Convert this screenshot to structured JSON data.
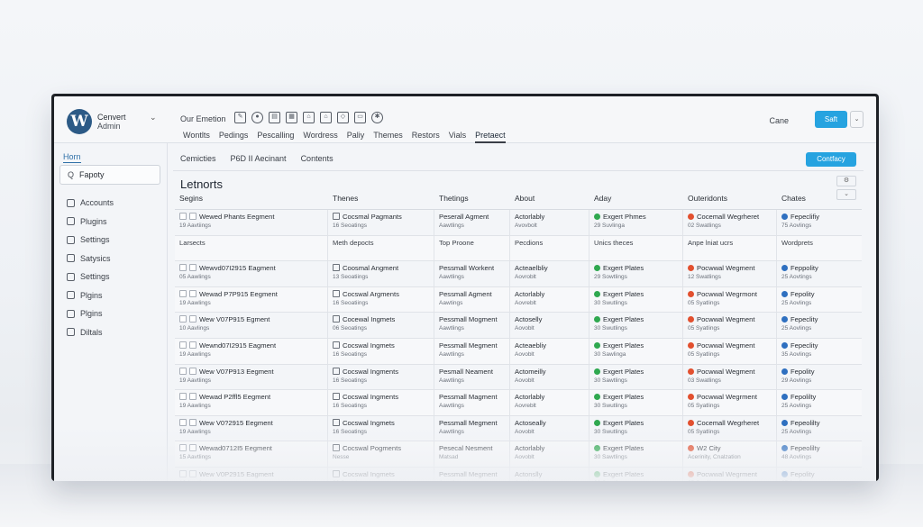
{
  "app": {
    "site_name": "Cenvert",
    "site_sub": "Admin",
    "logo_letter": "W",
    "toolbar_label": "Our Emetion",
    "cane_label": "Cane",
    "save_label": "Saft",
    "nav_tabs": [
      "Wontlts",
      "Pedings",
      "Pescalling",
      "Wordress",
      "Paliy",
      "Themes",
      "Restors",
      "Vials",
      "Pretaect"
    ]
  },
  "sidebar": {
    "home": "Horn",
    "search": "Fapoty",
    "items": [
      "Accounts",
      "Plugins",
      "Settings",
      "Satysics",
      "Settings",
      "Plgins",
      "Plgins",
      "Diltals"
    ]
  },
  "main": {
    "subtabs": [
      "Cemicties",
      "P6D II Aecinant",
      "Contents"
    ],
    "primary_button": "Contfacy",
    "title": "Letnorts",
    "headers": [
      "Segins",
      "Thenes",
      "Thetings",
      "About",
      "Aday",
      "Outeridonts",
      "Chates"
    ],
    "rows": [
      {
        "section": false,
        "c0": "Wewed Phants Eegment",
        "c0s": "19 Aavtiings",
        "c1": "Cocsmal Pagmants",
        "c1s": "16 Seoatings",
        "c2": "Peserall Agment",
        "c2s": "Aawtlings",
        "c3": "Actorlably",
        "c3s": "Avovbolt",
        "c4": "Exgert Phmes",
        "c4s": "29 Suvlinga",
        "c5": "Cocemall Wegrheret",
        "c5s": "02 Swatlings",
        "c6": "Fepeclifiy",
        "c6s": "75 Aovlings"
      },
      {
        "section": true,
        "c0": "Larsects",
        "c0s": "",
        "c1": "Meth depocts",
        "c1s": "",
        "c2": "Top Proone",
        "c2s": "",
        "c3": "Pecdions",
        "c3s": "",
        "c4": "Unics theces",
        "c4s": "",
        "c5": "Anpe lniat ucrs",
        "c5s": "",
        "c6": "Wordprets",
        "c6s": ""
      },
      {
        "section": false,
        "c0": "Wewvd07I2915 Eagment",
        "c0s": "05 Aawlings",
        "c1": "Coosmal Angment",
        "c1s": "13 Seoatiings",
        "c2": "Pessmall Workent",
        "c2s": "Aawtlings",
        "c3": "Acteaelbliy",
        "c3s": "Aovroblt",
        "c4": "Exgert Plates",
        "c4s": "29 Sowtlings",
        "c5": "Pocwwal Wegment",
        "c5s": "12 Swatlings",
        "c6": "Feppolity",
        "c6s": "25 Aovtings"
      },
      {
        "section": false,
        "c0": "Wewad P7P915 Eegment",
        "c0s": "19 Aawlings",
        "c1": "Cocswal Argments",
        "c1s": "16 Seoatiings",
        "c2": "Pessmall Agment",
        "c2s": "Aawtings",
        "c3": "Actorlably",
        "c3s": "Aovreblt",
        "c4": "Exgert Plates",
        "c4s": "30 Swutlings",
        "c5": "Pocwwal Wegrmont",
        "c5s": "05 Syatlings",
        "c6": "Fepolity",
        "c6s": "25 Aovlings"
      },
      {
        "section": false,
        "c0": "Wew V07P915 Egment",
        "c0s": "10 Aavlings",
        "c1": "Cocewal Ingmets",
        "c1s": "06 Seoatings",
        "c2": "Pessmall Mogment",
        "c2s": "Aawtlings",
        "c3": "Actoselly",
        "c3s": "Aovoblt",
        "c4": "Exgert Plates",
        "c4s": "30 Swutlings",
        "c5": "Pocwwal Wegment",
        "c5s": "05 Syatlings",
        "c6": "Fepeclity",
        "c6s": "25 Aovlings"
      },
      {
        "section": false,
        "c0": "Wewnd07I2915 Eagment",
        "c0s": "19 Aawlings",
        "c1": "Cocswal Ingmets",
        "c1s": "16 Seoatings",
        "c2": "Pessmall Megment",
        "c2s": "Aawtlings",
        "c3": "Acteaebliy",
        "c3s": "Aovoblt",
        "c4": "Exgert Plates",
        "c4s": "30 Sawlinga",
        "c5": "Pocwwal Wegment",
        "c5s": "05 Syatlings",
        "c6": "Fepeclity",
        "c6s": "35 Aovlings"
      },
      {
        "section": false,
        "c0": "Wew V07P913 Eegment",
        "c0s": "19 Aavtlings",
        "c1": "Cocswal Ingments",
        "c1s": "16 Seoatings",
        "c2": "Pesmall Neament",
        "c2s": "Aawtlings",
        "c3": "Actomeilly",
        "c3s": "Aovoblt",
        "c4": "Exgert Plates",
        "c4s": "30 Sawtlings",
        "c5": "Pocwwal Wegment",
        "c5s": "03 Swatlings",
        "c6": "Fepolity",
        "c6s": "29 Aovlings"
      },
      {
        "section": false,
        "c0": "Wewad P2ffl5 Eegment",
        "c0s": "19 Aawlings",
        "c1": "Cocswal Ingments",
        "c1s": "16 Seoatings",
        "c2": "Pessmall Magment",
        "c2s": "Aawtlings",
        "c3": "Actorlably",
        "c3s": "Aovreblt",
        "c4": "Exgert Plates",
        "c4s": "30 Swutlings",
        "c5": "Pocwwal Wegrment",
        "c5s": "05 Syatlings",
        "c6": "Fepolilty",
        "c6s": "25 Aovlings"
      },
      {
        "section": false,
        "c0": "Wew V0?2915 Eegment",
        "c0s": "19 Aawlings",
        "c1": "Cocswal Ingmets",
        "c1s": "16 Seoatings",
        "c2": "Pessmall Megment",
        "c2s": "Aawtlings",
        "c3": "Actoseally",
        "c3s": "Aovoblt",
        "c4": "Exgert Plates",
        "c4s": "30 Swutlings",
        "c5": "Cocemall Wegrheret",
        "c5s": "05 Syatlings",
        "c6": "Fepeolilty",
        "c6s": "25 Aovlings"
      },
      {
        "section": false,
        "c0": "Wewad0712I5 Eegment",
        "c0s": "15 Aavtlings",
        "c1": "Cocswal Pogments",
        "c1s": "Nesse",
        "c2": "Pesecal Nesment",
        "c2s": "Matsad",
        "c3": "Actorlably",
        "c3s": "Aovoblt",
        "c4": "Exgert Plates",
        "c4s": "30 Sawtlings",
        "c5": "W2 City",
        "c5s": "Acerinity, Cnalzation",
        "c6": "Fepeolilty",
        "c6s": "48 Aovlings"
      },
      {
        "section": false,
        "c0": "Wew V0P2915 Eagment",
        "c0s": "19 Aawlings",
        "c1": "Cocswal Ingmets",
        "c1s": "26 Seoatings",
        "c2": "Pessmall Megment",
        "c2s": "Aawtlings",
        "c3": "Actonslly",
        "c3s": "Aovoblt",
        "c4": "Exgert Plates",
        "c4s": "30 Swutlings",
        "c5": "Pocwwal Wegrment",
        "c5s": "05 Syatlings",
        "c6": "Fepolity",
        "c6s": "25 Aovlings"
      }
    ]
  },
  "colors": {
    "accent": "#26a3e0",
    "status_green": "#2fa84f",
    "status_red": "#e2502f",
    "status_blue": "#2f70c0"
  }
}
